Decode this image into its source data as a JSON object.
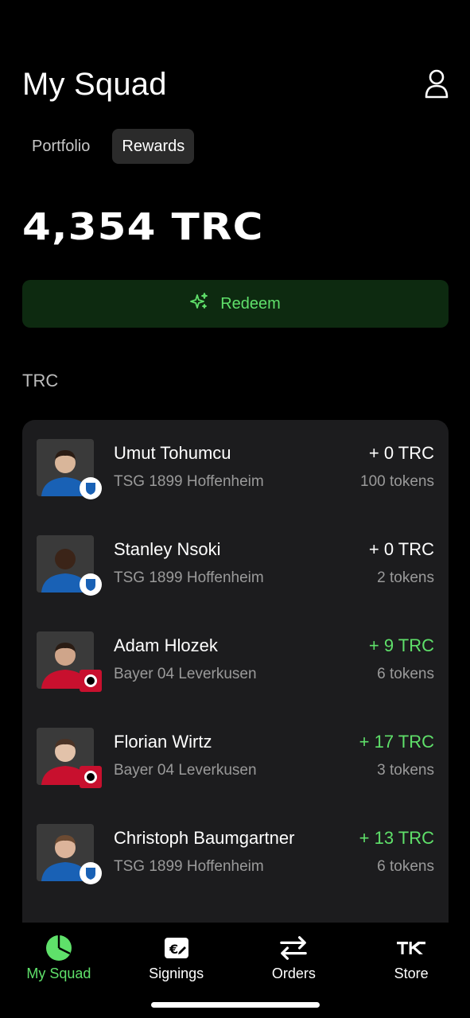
{
  "header": {
    "title": "My Squad",
    "profile_icon": "user-icon"
  },
  "tabs": [
    {
      "label": "Portfolio",
      "active": false
    },
    {
      "label": "Rewards",
      "active": true
    }
  ],
  "balance": "4,354 TRC",
  "redeem": {
    "label": "Redeem",
    "icon": "sparkle-icon"
  },
  "section_label": "TRC",
  "players": [
    {
      "name": "Umut Tohumcu",
      "club": "TSG 1899 Hoffenheim",
      "reward": "+ 0 TRC",
      "tokens": "100 tokens",
      "positive": false,
      "club_color": "#1961b5"
    },
    {
      "name": "Stanley Nsoki",
      "club": "TSG 1899 Hoffenheim",
      "reward": "+ 0 TRC",
      "tokens": "2 tokens",
      "positive": false,
      "club_color": "#1961b5"
    },
    {
      "name": "Adam Hlozek",
      "club": "Bayer 04 Leverkusen",
      "reward": "+ 9 TRC",
      "tokens": "6 tokens",
      "positive": true,
      "club_color": "#c8102e"
    },
    {
      "name": "Florian Wirtz",
      "club": "Bayer 04 Leverkusen",
      "reward": "+ 17 TRC",
      "tokens": "3 tokens",
      "positive": true,
      "club_color": "#c8102e"
    },
    {
      "name": "Christoph Baumgartner",
      "club": "TSG 1899 Hoffenheim",
      "reward": "+ 13 TRC",
      "tokens": "6 tokens",
      "positive": true,
      "club_color": "#1961b5"
    }
  ],
  "tabbar": [
    {
      "label": "My Squad",
      "icon": "pie-chart-icon",
      "active": true
    },
    {
      "label": "Signings",
      "icon": "euro-document-icon",
      "active": false
    },
    {
      "label": "Orders",
      "icon": "swap-arrows-icon",
      "active": false
    },
    {
      "label": "Store",
      "icon": "store-logo-icon",
      "active": false
    }
  ],
  "colors": {
    "accent": "#5fe06a",
    "redeem_bg": "#0d2a10",
    "card_bg": "#1c1c1e"
  }
}
